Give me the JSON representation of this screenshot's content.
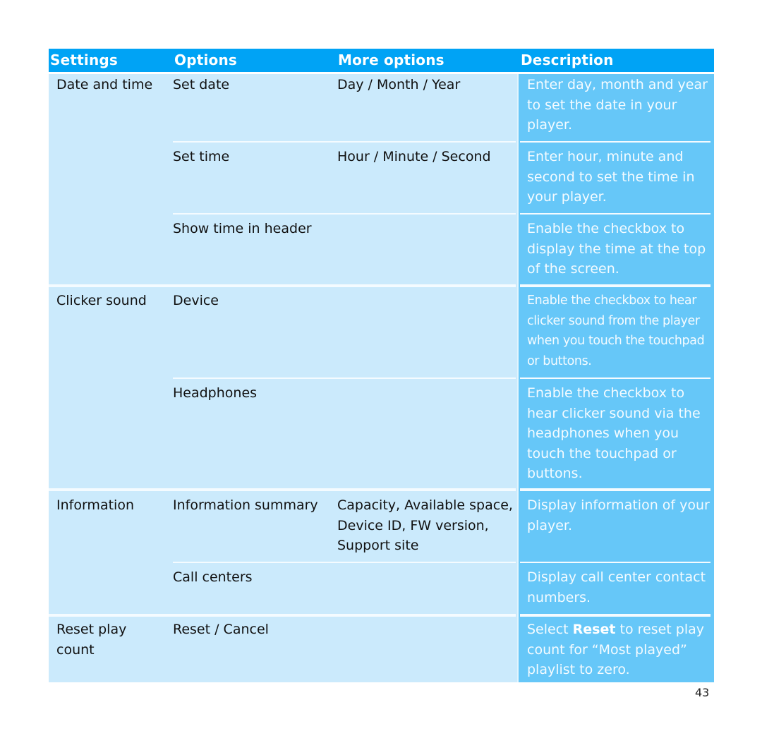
{
  "table": {
    "headers": {
      "settings": "Settings",
      "options": "Options",
      "more_options": "More options",
      "description": "Description"
    },
    "rows": [
      {
        "setting": "Date and time",
        "option": "Set date",
        "more": "Day / Month / Year",
        "description": "Enter day, month and year to set the date in your player."
      },
      {
        "setting": "",
        "option": "Set time",
        "more": "Hour / Minute / Second",
        "description": "Enter hour, minute and second to set the time in your player."
      },
      {
        "setting": "",
        "option": "Show time in header",
        "more": "",
        "description": "Enable the checkbox to display the time at the top of the screen."
      },
      {
        "setting": "Clicker sound",
        "option": "Device",
        "more": "",
        "description": "Enable the checkbox to hear clicker sound from the player when you touch the touchpad or buttons."
      },
      {
        "setting": "",
        "option": "Headphones",
        "more": "",
        "description": "Enable the checkbox to hear clicker sound via the headphones when you touch the touchpad or buttons."
      },
      {
        "setting": "Information",
        "option": "Information summary",
        "more": "Capacity, Available space, Device ID, FW version, Support site",
        "description": "Display information of your player."
      },
      {
        "setting": "",
        "option": "Call centers",
        "more": "",
        "description": "Display call center contact numbers."
      },
      {
        "setting": "Reset play count",
        "option": "Reset / Cancel",
        "more": "",
        "description_parts": {
          "before": "Select ",
          "bold": "Reset",
          "after": " to reset play count for “Most played” playlist to zero."
        }
      }
    ]
  },
  "page_number": "43",
  "colors": {
    "header_bg": "#00a3f5",
    "body_bg": "#cbeafc",
    "description_bg": "#66c7f8"
  }
}
